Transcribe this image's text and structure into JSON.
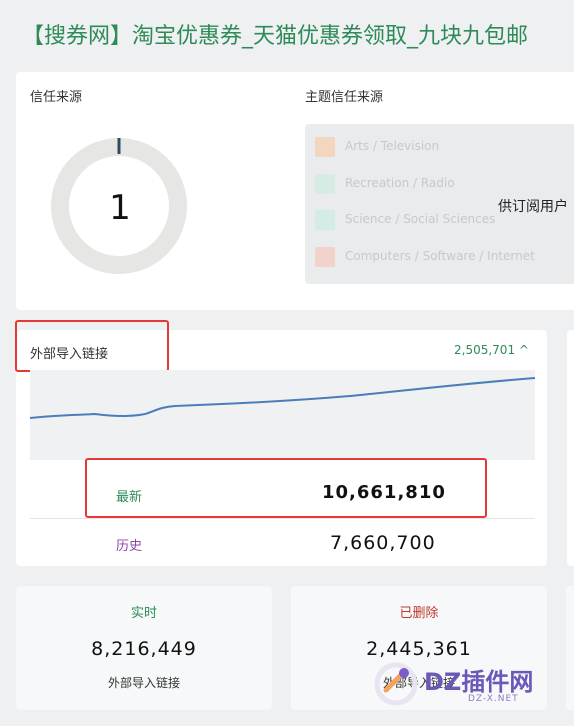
{
  "page": {
    "title": "【搜券网】淘宝优惠券_天猫优惠券领取_九块九包邮"
  },
  "trust": {
    "label": "信任来源",
    "value": "1",
    "topic_label": "主题信任来源",
    "topics": [
      {
        "name": "Arts / Television",
        "color": "#f3d6bf"
      },
      {
        "name": "Recreation / Radio",
        "color": "#d6ebe3"
      },
      {
        "name": "Science / Social Sciences",
        "color": "#d3ece6"
      },
      {
        "name": "Computers / Software / Internet",
        "color": "#f2d3cc"
      }
    ],
    "subscriber_text": "供订阅用户"
  },
  "external_links": {
    "label": "外部导入链接",
    "count": "2,505,701",
    "latest_label": "最新",
    "latest_value": "10,661,810",
    "history_label": "历史",
    "history_value": "7,660,700"
  },
  "stats": [
    {
      "heading": "实时",
      "heading_color": "#2e8b57",
      "value": "8,216,449",
      "sub": "外部导入链接"
    },
    {
      "heading": "已删除",
      "heading_color": "#c0392b",
      "value": "2,445,361",
      "sub": "外部导入链接"
    }
  ],
  "watermark": {
    "text": "DZ插件网",
    "sub": "DZ-X.NET"
  }
}
